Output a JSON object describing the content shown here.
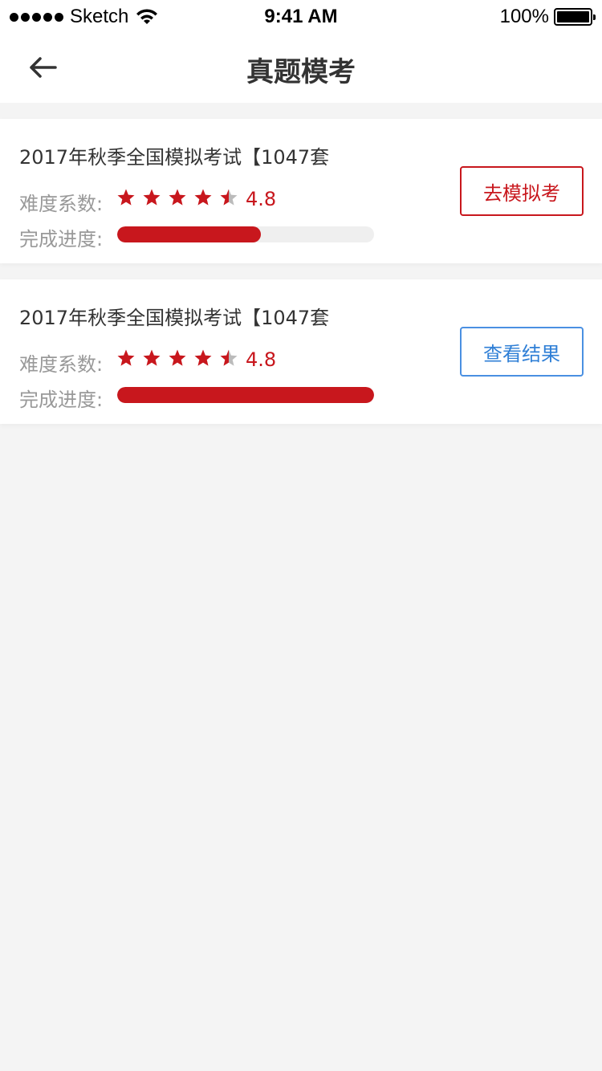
{
  "status_bar": {
    "carrier": "Sketch",
    "time": "9:41 AM",
    "battery": "100%"
  },
  "nav": {
    "title": "真题模考"
  },
  "labels": {
    "difficulty": "难度系数:",
    "progress": "完成进度:"
  },
  "colors": {
    "accent_red": "#c8171d",
    "accent_blue": "#4a90e2",
    "star_empty": "#bbbbbb"
  },
  "exams": [
    {
      "title": "2017年秋季全国模拟考试【1047套",
      "rating": "4.8",
      "stars": 4.5,
      "progress": 0.56,
      "action": "去模拟考",
      "action_style": "red"
    },
    {
      "title": "2017年秋季全国模拟考试【1047套",
      "rating": "4.8",
      "stars": 4.5,
      "progress": 1.0,
      "action": "查看结果",
      "action_style": "blue"
    }
  ]
}
